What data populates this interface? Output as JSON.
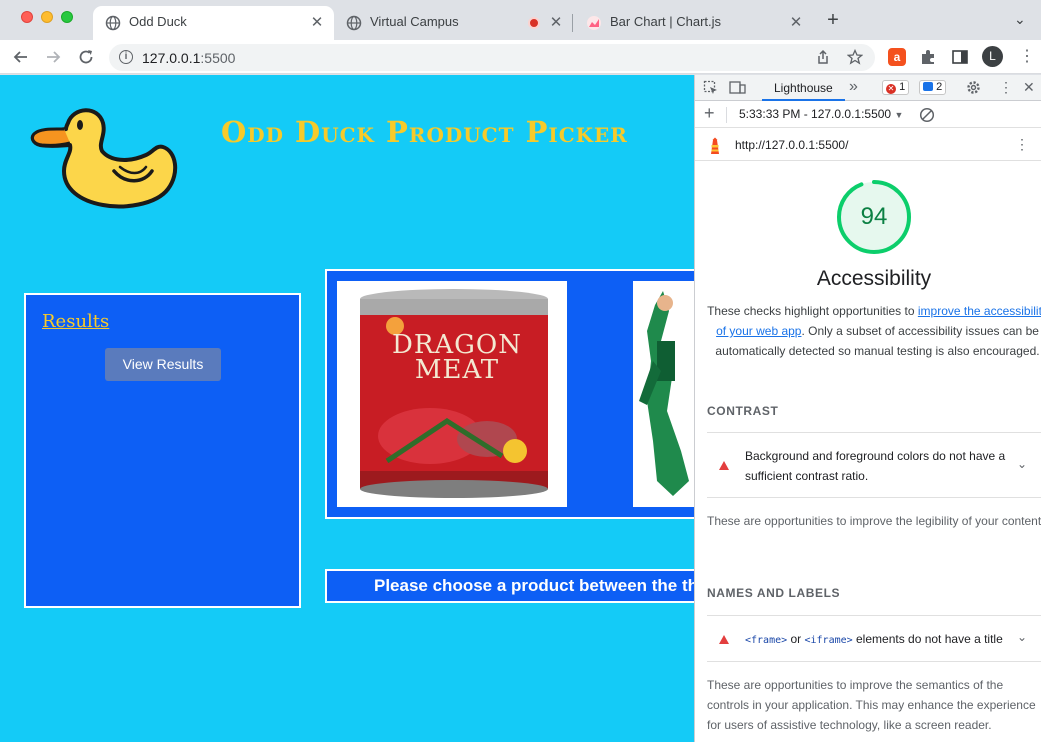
{
  "browser": {
    "tabs": [
      {
        "title": "Odd Duck",
        "close": "✕"
      },
      {
        "title": "Virtual Campus",
        "close": "✕"
      },
      {
        "title": "Bar Chart | Chart.js",
        "close": "✕"
      }
    ],
    "new_tab": "+",
    "tab_menu": "⌄",
    "address": {
      "host": "127.0.0.1",
      "port": ":5500"
    },
    "avatar_letter": "L"
  },
  "page": {
    "title": "Odd Duck Product Picker",
    "results_heading": "Results",
    "view_results_button": "View Results",
    "product_name": "Dragon Meat",
    "instructions": "Please choose a product between the three"
  },
  "devtools": {
    "active_tab": "Lighthouse",
    "more_tabs": "»",
    "error_count": "1",
    "message_count": "2",
    "report_time": "5:33:33 PM - 127.0.0.1:5500",
    "report_url": "http://127.0.0.1:5500/",
    "score": "94",
    "score_fraction": 0.94,
    "category_title": "Accessibility",
    "desc_before": "These checks highlight opportunities to ",
    "desc_link": "improve the accessibility of your web app",
    "desc_after": ". Only a subset of accessibility issues can be automatically detected so manual testing is also encouraged.",
    "groups": [
      {
        "title": "CONTRAST",
        "audit": "Background and foreground colors do not have a sufficient contrast ratio.",
        "desc": "These are opportunities to improve the legibility of your content."
      },
      {
        "title": "NAMES AND LABELS",
        "audit_code1": "<frame>",
        "audit_mid": " or ",
        "audit_code2": "<iframe>",
        "audit_tail": " elements do not have a title",
        "desc": "These are opportunities to improve the semantics of the controls in your application. This may enhance the experience for users of assistive technology, like a screen reader."
      }
    ],
    "colors": {
      "pass": "#0cce6b",
      "fail": "#e33e3e"
    }
  }
}
